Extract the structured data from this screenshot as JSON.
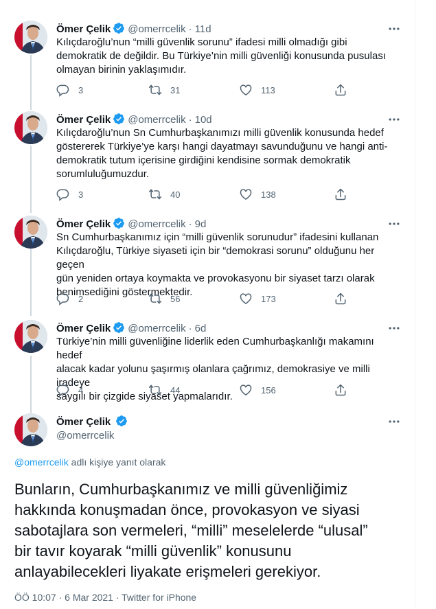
{
  "colors": {
    "accent": "#1d9bf0",
    "text": "#0f1419",
    "muted": "#536471",
    "thread": "#cfd9de"
  },
  "icons": {
    "verified": "verified-badge-icon",
    "more": "more-icon",
    "reply": "reply-icon",
    "retweet": "retweet-icon",
    "like": "like-icon",
    "share": "share-icon"
  },
  "tweets": [
    {
      "name": "Ömer Çelik",
      "handle": "@omerrcelik",
      "separator": "·",
      "time": "11d",
      "lines": [
        "Kılıçdaroğlu’nun “milli güvenlik sorunu” ifadesi milli olmadığı gibi",
        "demokratik de değildir. Bu Türkiye’nin milli güvenliği konusunda pusulası",
        "olmayan birinin yaklaşımıdır."
      ],
      "replies": "3",
      "retweets": "31",
      "likes": "113"
    },
    {
      "name": "Ömer Çelik",
      "handle": "@omerrcelik",
      "separator": "·",
      "time": "10d",
      "lines": [
        "Kılıçdaroğlu’nun Sn Cumhurbaşkanımızı milli güvenlik konusunda hedef",
        "göstererek Türkiye’ye karşı hangi dayatmayı savunduğunu ve hangi anti-",
        "demokratik tutum içerisine girdiğini kendisine sormak demokratik",
        "sorumluluğumuzdur."
      ],
      "replies": "3",
      "retweets": "40",
      "likes": "138"
    },
    {
      "name": "Ömer Çelik",
      "handle": "@omerrcelik",
      "separator": "·",
      "time": "9d",
      "lines": [
        "Sn Cumhurbaşkanımız için “milli güvenlik sorunudur” ifadesini kullanan",
        "Kılıçdaroğlu, Türkiye siyaseti için bir “demokrasi sorunu” olduğunu her geçen",
        "gün yeniden ortaya koymakta ve provokasyonu bir siyaset tarzı olarak",
        "benimsediğini göstermektedir."
      ],
      "replies": "2",
      "retweets": "56",
      "likes": "173"
    },
    {
      "name": "Ömer Çelik",
      "handle": "@omerrcelik",
      "separator": "·",
      "time": "6d",
      "lines": [
        "Türkiye’nin milli güvenliğine liderlik eden Cumhurbaşkanlığı makamını hedef",
        "alacak kadar yolunu şaşırmış olanlara çağrımız, demokrasiye ve milli iradeye",
        "saygılı bir çizgide siyaset yapmalarıdır."
      ],
      "replies": "4",
      "retweets": "44",
      "likes": "156"
    }
  ],
  "main": {
    "name": "Ömer Çelik",
    "handle": "@omerrcelik",
    "reply_handle": "@omerrcelik",
    "reply_suffix": " adlı kişiye yanıt olarak",
    "lines": [
      "Bunların, Cumhurbaşkanımız ve milli güvenliğimiz",
      "hakkında konuşmadan önce, provokasyon ve siyasi",
      "sabotajlara son vermeleri, “milli” meselelerde “ulusal”",
      "bir tavır koyarak “milli güvenlik” konusunu",
      "anlayabilecekleri liyakate erişmeleri gerekiyor."
    ],
    "meta": "ÖÖ 10:07 · 6 Mar 2021 · Twitter for iPhone"
  }
}
